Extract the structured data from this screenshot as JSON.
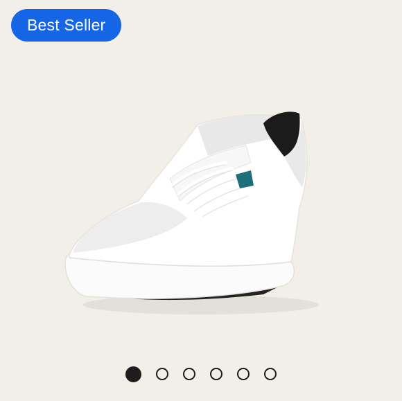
{
  "badge": {
    "label": "Best Seller",
    "color": "#1565e6"
  },
  "product": {
    "icon": "white-sneaker-image",
    "accent_color": "#1f6f7a"
  },
  "carousel": {
    "total": 6,
    "active_index": 0
  }
}
